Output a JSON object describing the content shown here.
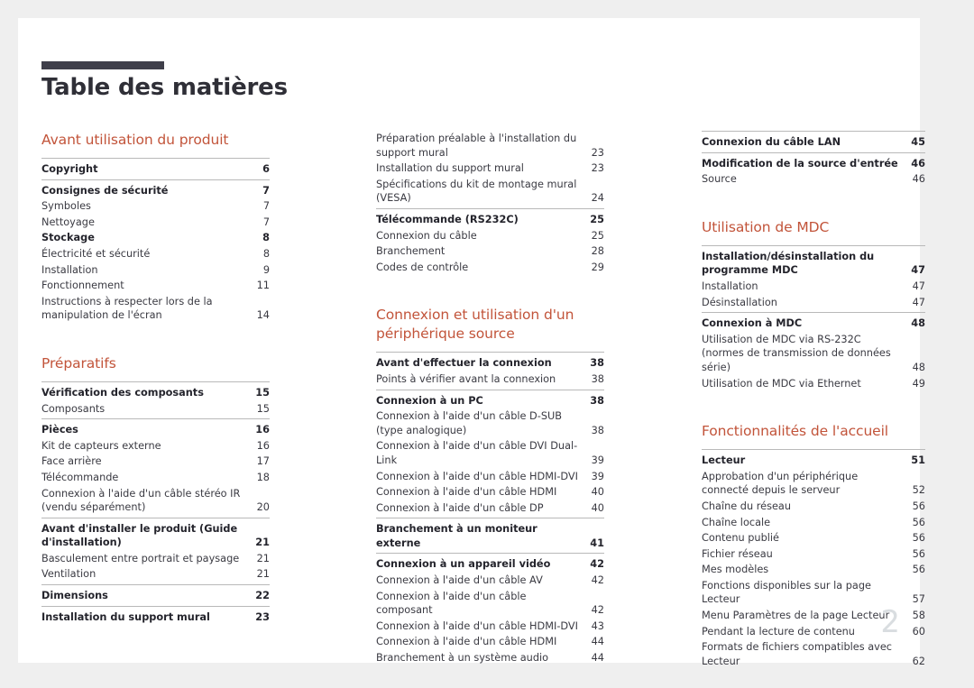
{
  "document": {
    "title": "Table des matières",
    "folio": "2",
    "accent_color": "#c2543a",
    "rule_color": "#b9b9b9",
    "title_bar_color": "#3f3f4a",
    "folio_color": "#d9dde0"
  },
  "columns": [
    {
      "name": "column-1",
      "sections": [
        {
          "heading": "Avant utilisation du produit",
          "spaced_top": false,
          "groups": [
            {
              "rule": true,
              "entries": [
                {
                  "label": "Copyright",
                  "page": "6",
                  "bold": true
                }
              ]
            },
            {
              "rule": true,
              "entries": [
                {
                  "label": "Consignes de sécurité",
                  "page": "7",
                  "bold": true
                },
                {
                  "label": "Symboles",
                  "page": "7",
                  "bold": false
                },
                {
                  "label": "Nettoyage",
                  "page": "7",
                  "bold": false
                },
                {
                  "label": "Stockage",
                  "page": "8",
                  "bold": true
                },
                {
                  "label": "Électricité et sécurité",
                  "page": "8",
                  "bold": false
                },
                {
                  "label": "Installation",
                  "page": "9",
                  "bold": false
                },
                {
                  "label": "Fonctionnement",
                  "page": "11",
                  "bold": false
                },
                {
                  "label": "Instructions à respecter lors de la manipulation de l'écran",
                  "page": "14",
                  "bold": false
                }
              ]
            }
          ]
        },
        {
          "heading": "Préparatifs",
          "spaced_top": true,
          "groups": [
            {
              "rule": true,
              "entries": [
                {
                  "label": "Vérification des composants",
                  "page": "15",
                  "bold": true
                },
                {
                  "label": "Composants",
                  "page": "15",
                  "bold": false
                }
              ]
            },
            {
              "rule": true,
              "entries": [
                {
                  "label": "Pièces",
                  "page": "16",
                  "bold": true
                },
                {
                  "label": "Kit de capteurs externe",
                  "page": "16",
                  "bold": false
                },
                {
                  "label": "Face arrière",
                  "page": "17",
                  "bold": false
                },
                {
                  "label": "Télécommande",
                  "page": "18",
                  "bold": false
                },
                {
                  "label": "Connexion à l'aide d'un câble stéréo IR (vendu séparément)",
                  "page": "20",
                  "bold": false
                }
              ]
            },
            {
              "rule": true,
              "entries": [
                {
                  "label": "Avant d'installer le produit (Guide d'installation)",
                  "page": "21",
                  "bold": true
                },
                {
                  "label": "Basculement entre portrait et paysage",
                  "page": "21",
                  "bold": false
                },
                {
                  "label": "Ventilation",
                  "page": "21",
                  "bold": false
                }
              ]
            },
            {
              "rule": true,
              "entries": [
                {
                  "label": "Dimensions",
                  "page": "22",
                  "bold": true
                }
              ]
            },
            {
              "rule": true,
              "entries": [
                {
                  "label": "Installation du support mural",
                  "page": "23",
                  "bold": true
                }
              ]
            }
          ]
        }
      ]
    },
    {
      "name": "column-2",
      "sections": [
        {
          "heading": "",
          "spaced_top": false,
          "groups": [
            {
              "rule": false,
              "entries": [
                {
                  "label": "Préparation préalable à l'installation du support mural",
                  "page": "23",
                  "bold": false
                },
                {
                  "label": "Installation du support mural",
                  "page": "23",
                  "bold": false
                },
                {
                  "label": "Spécifications du kit de montage mural (VESA)",
                  "page": "24",
                  "bold": false
                }
              ]
            },
            {
              "rule": true,
              "entries": [
                {
                  "label": "Télécommande (RS232C)",
                  "page": "25",
                  "bold": true
                },
                {
                  "label": "Connexion du câble",
                  "page": "25",
                  "bold": false
                },
                {
                  "label": "Branchement",
                  "page": "28",
                  "bold": false
                },
                {
                  "label": "Codes de contrôle",
                  "page": "29",
                  "bold": false
                }
              ]
            }
          ]
        },
        {
          "heading": "Connexion et utilisation d'un périphérique source",
          "spaced_top": true,
          "groups": [
            {
              "rule": true,
              "entries": [
                {
                  "label": "Avant d'effectuer la connexion",
                  "page": "38",
                  "bold": true
                },
                {
                  "label": "Points à vérifier avant la connexion",
                  "page": "38",
                  "bold": false
                }
              ]
            },
            {
              "rule": true,
              "entries": [
                {
                  "label": "Connexion à un PC",
                  "page": "38",
                  "bold": true
                },
                {
                  "label": "Connexion à l'aide d'un câble D-SUB (type analogique)",
                  "page": "38",
                  "bold": false
                },
                {
                  "label": "Connexion à l'aide d'un câble DVI Dual-Link",
                  "page": "39",
                  "bold": false
                },
                {
                  "label": "Connexion à l'aide d'un câble HDMI-DVI",
                  "page": "39",
                  "bold": false
                },
                {
                  "label": "Connexion à l'aide d'un câble HDMI",
                  "page": "40",
                  "bold": false
                },
                {
                  "label": "Connexion à l'aide d'un câble DP",
                  "page": "40",
                  "bold": false
                }
              ]
            },
            {
              "rule": true,
              "entries": [
                {
                  "label": "Branchement à un moniteur externe",
                  "page": "41",
                  "bold": true
                }
              ]
            },
            {
              "rule": true,
              "entries": [
                {
                  "label": "Connexion à un appareil vidéo",
                  "page": "42",
                  "bold": true
                },
                {
                  "label": "Connexion à l'aide d'un câble AV",
                  "page": "42",
                  "bold": false
                },
                {
                  "label": "Connexion à l'aide d'un câble composant",
                  "page": "42",
                  "bold": false
                },
                {
                  "label": "Connexion à l'aide d'un câble HDMI-DVI",
                  "page": "43",
                  "bold": false
                },
                {
                  "label": "Connexion à l'aide d'un câble HDMI",
                  "page": "44",
                  "bold": false
                },
                {
                  "label": "Branchement à un système audio",
                  "page": "44",
                  "bold": false
                }
              ]
            }
          ]
        }
      ]
    },
    {
      "name": "column-3",
      "sections": [
        {
          "heading": "",
          "spaced_top": false,
          "groups": [
            {
              "rule": true,
              "entries": [
                {
                  "label": "Connexion du câble LAN",
                  "page": "45",
                  "bold": true
                }
              ]
            },
            {
              "rule": true,
              "entries": [
                {
                  "label": "Modification de la source d'entrée",
                  "page": "46",
                  "bold": true
                },
                {
                  "label": "Source",
                  "page": "46",
                  "bold": false
                }
              ]
            }
          ]
        },
        {
          "heading": "Utilisation de MDC",
          "spaced_top": true,
          "groups": [
            {
              "rule": true,
              "entries": [
                {
                  "label": "Installation/désinstallation du programme MDC",
                  "page": "47",
                  "bold": true
                },
                {
                  "label": "Installation",
                  "page": "47",
                  "bold": false
                },
                {
                  "label": "Désinstallation",
                  "page": "47",
                  "bold": false
                }
              ]
            },
            {
              "rule": true,
              "entries": [
                {
                  "label": "Connexion à MDC",
                  "page": "48",
                  "bold": true
                },
                {
                  "label": "Utilisation de MDC via RS-232C (normes de transmission de données série)",
                  "page": "48",
                  "bold": false
                },
                {
                  "label": "Utilisation de MDC via Ethernet",
                  "page": "49",
                  "bold": false
                }
              ]
            }
          ]
        },
        {
          "heading": "Fonctionnalités de l'accueil",
          "spaced_top": true,
          "groups": [
            {
              "rule": true,
              "entries": [
                {
                  "label": "Lecteur",
                  "page": "51",
                  "bold": true
                },
                {
                  "label": "Approbation d'un périphérique connecté depuis le serveur",
                  "page": "52",
                  "bold": false
                },
                {
                  "label": "Chaîne du réseau",
                  "page": "56",
                  "bold": false
                },
                {
                  "label": "Chaîne locale",
                  "page": "56",
                  "bold": false
                },
                {
                  "label": "Contenu publié",
                  "page": "56",
                  "bold": false
                },
                {
                  "label": "Fichier réseau",
                  "page": "56",
                  "bold": false
                },
                {
                  "label": "Mes modèles",
                  "page": "56",
                  "bold": false
                },
                {
                  "label": "Fonctions disponibles sur la page Lecteur",
                  "page": "57",
                  "bold": false
                },
                {
                  "label": "Menu Paramètres de la page Lecteur",
                  "page": "58",
                  "bold": false
                },
                {
                  "label": "Pendant la lecture de contenu",
                  "page": "60",
                  "bold": false
                },
                {
                  "label": "Formats de fichiers compatibles avec Lecteur",
                  "page": "62",
                  "bold": false
                }
              ]
            }
          ]
        }
      ]
    }
  ]
}
